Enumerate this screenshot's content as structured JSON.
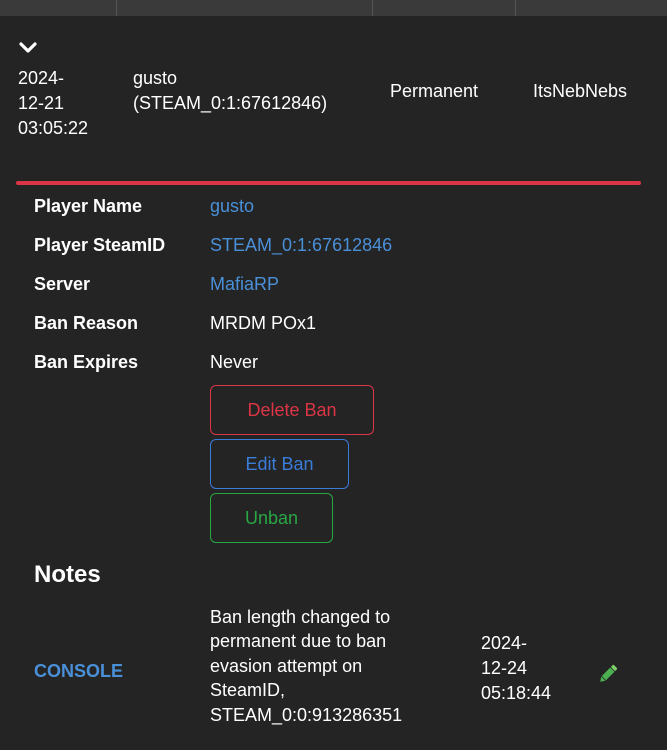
{
  "ban_row": {
    "date_lines": [
      "2024-",
      "12-21",
      "03:05:22"
    ],
    "player_lines": [
      "gusto",
      "(STEAM_0:1:67612846)"
    ],
    "length": "Permanent",
    "admin": "ItsNebNebs"
  },
  "details": {
    "player_name_label": "Player Name",
    "player_name": "gusto",
    "steamid_label": "Player SteamID",
    "steamid": "STEAM_0:1:67612846",
    "server_label": "Server",
    "server": "MafiaRP",
    "reason_label": "Ban Reason",
    "reason": "MRDM POx1",
    "expires_label": "Ban Expires",
    "expires": "Never"
  },
  "actions": {
    "delete_label": "Delete Ban",
    "edit_label": "Edit Ban",
    "unban_label": "Unban"
  },
  "notes": {
    "title": "Notes",
    "items": [
      {
        "author": "CONSOLE",
        "text_lines": [
          "Ban length changed to",
          "permanent due to ban",
          "evasion attempt on",
          "SteamID,",
          "STEAM_0:0:913286351"
        ],
        "date_lines": [
          "2024-",
          "12-24",
          "05:18:44"
        ]
      }
    ]
  },
  "icons": {
    "expand": "chevron-down-icon",
    "edit_note": "pencil-icon"
  },
  "colors": {
    "background": "#242424",
    "danger": "#dc3545",
    "primary": "#3a7cd9",
    "success": "#28a745",
    "link": "#4a90d9"
  }
}
